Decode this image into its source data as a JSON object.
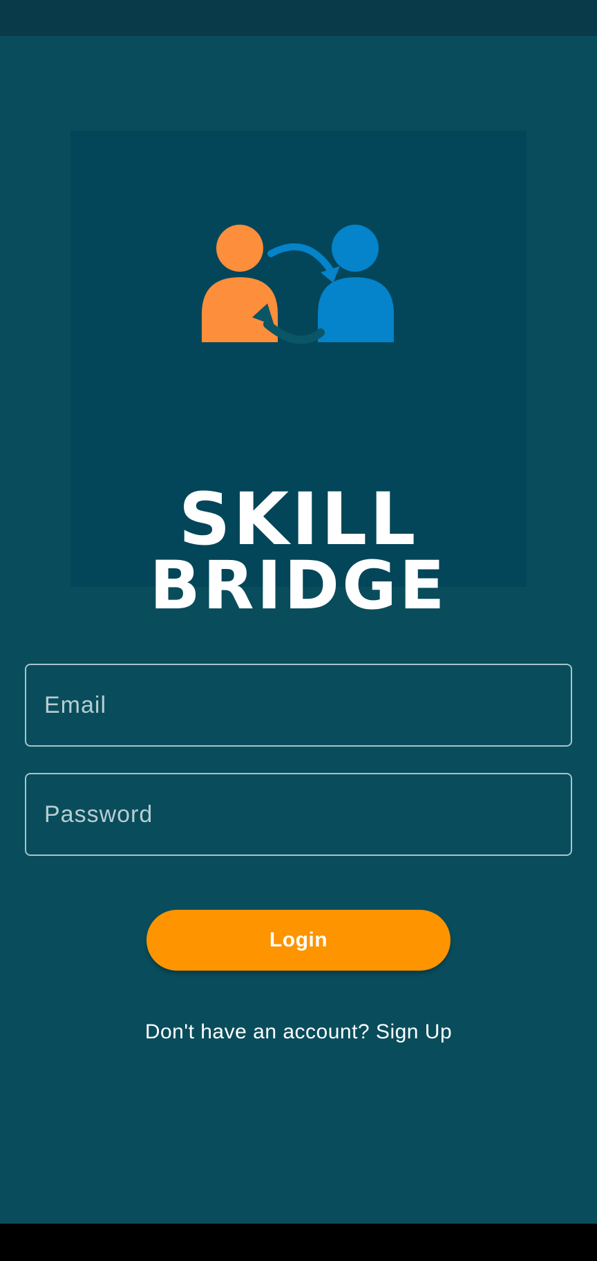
{
  "app": {
    "logo": {
      "line1": "SKILL",
      "line2": "BRIDGE",
      "icon": "two-people-exchange-icon",
      "colors": {
        "left_person": "#fc8e3c",
        "right_person": "#0583cb",
        "background": "#034659"
      }
    }
  },
  "form": {
    "email": {
      "placeholder": "Email",
      "value": ""
    },
    "password": {
      "placeholder": "Password",
      "value": ""
    },
    "login_label": "Login",
    "signup_text": "Don't have an account? Sign Up"
  },
  "colors": {
    "background": "#094d5c",
    "accent": "#fd9400",
    "status_bar": "#083a49"
  }
}
